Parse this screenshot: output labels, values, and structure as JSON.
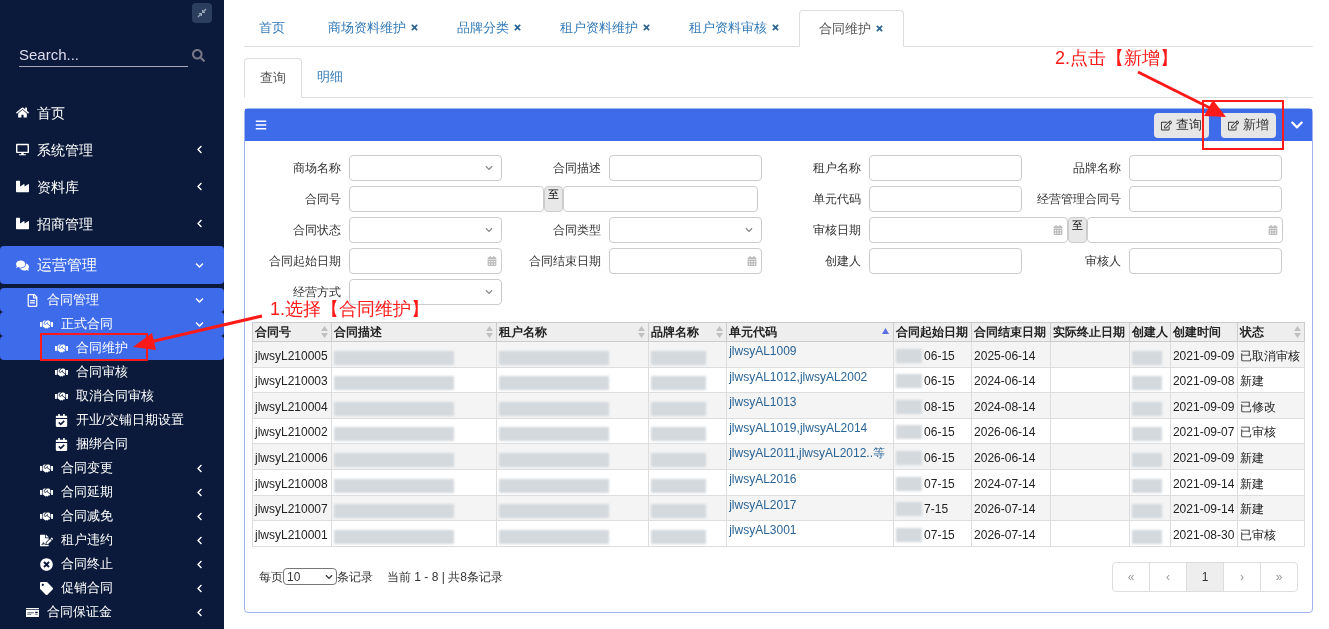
{
  "sidebar": {
    "search": {
      "placeholder": "Search..."
    },
    "items": [
      {
        "label": "首页"
      },
      {
        "label": "系统管理",
        "expanded": false
      },
      {
        "label": "资料库",
        "expanded": false
      },
      {
        "label": "招商管理",
        "expanded": false
      },
      {
        "label": "运营管理",
        "expanded": true,
        "children": [
          {
            "label": "合同管理",
            "expanded": true,
            "children": [
              {
                "label": "正式合同",
                "expanded": true,
                "children": [
                  {
                    "label": "合同维护",
                    "selected": true
                  },
                  {
                    "label": "合同审核",
                    "selected": false
                  },
                  {
                    "label": "取消合同审核",
                    "selected": false
                  },
                  {
                    "label": "开业/交铺日期设置",
                    "selected": false
                  },
                  {
                    "label": "捆绑合同",
                    "selected": false
                  }
                ]
              },
              {
                "label": "合同变更",
                "expanded": false
              },
              {
                "label": "合同延期",
                "expanded": false
              },
              {
                "label": "合同减免",
                "expanded": false
              },
              {
                "label": "租户违约",
                "expanded": false
              },
              {
                "label": "合同终止",
                "expanded": false
              },
              {
                "label": "促销合同",
                "expanded": false
              }
            ]
          },
          {
            "label": "合同保证金",
            "expanded": false
          }
        ]
      }
    ]
  },
  "tabs": [
    {
      "label": "首页",
      "selected": false
    },
    {
      "label": "商场资料维护",
      "closable": true,
      "selected": false
    },
    {
      "label": "品牌分类",
      "closable": true,
      "selected": false
    },
    {
      "label": "租户资料维护",
      "closable": true,
      "selected": false
    },
    {
      "label": "租户资料审核",
      "closable": true,
      "selected": false
    },
    {
      "label": "合同维护",
      "closable": true,
      "selected": true
    }
  ],
  "sub_tabs": [
    {
      "label": "查询",
      "selected": true
    },
    {
      "label": "明细",
      "selected": false
    }
  ],
  "toolbar": {
    "buttons": [
      "查询",
      "新增"
    ]
  },
  "filters": [
    [
      {
        "label": "商场名称",
        "kind": "select"
      },
      {
        "label": "合同描述",
        "kind": "text"
      },
      {
        "label": "租户名称",
        "kind": "text"
      },
      {
        "label": "品牌名称",
        "kind": "text"
      }
    ],
    [
      {
        "label": "合同号",
        "kind": "range",
        "separator": "至"
      },
      {
        "label": "单元代码",
        "kind": "text"
      },
      {
        "label": "经营管理合同号",
        "kind": "text"
      }
    ],
    [
      {
        "label": "合同状态",
        "kind": "select"
      },
      {
        "label": "合同类型",
        "kind": "select"
      },
      {
        "label": "审核日期",
        "kind": "daterange",
        "separator": "至"
      }
    ],
    [
      {
        "label": "合同起始日期",
        "kind": "date"
      },
      {
        "label": "合同结束日期",
        "kind": "date"
      },
      {
        "label": "创建人",
        "kind": "text"
      },
      {
        "label": "审核人",
        "kind": "text"
      }
    ],
    [
      {
        "label": "经营方式",
        "kind": "select"
      }
    ]
  ],
  "table": {
    "columns": [
      {
        "label": "合同号",
        "kind": "text",
        "sortable": true,
        "sorted": false
      },
      {
        "label": "合同描述",
        "kind": "blurred",
        "sortable": true,
        "sorted": false
      },
      {
        "label": "租户名称",
        "kind": "blurred",
        "sortable": true,
        "sorted": false
      },
      {
        "label": "品牌名称",
        "kind": "blurred",
        "sortable": true,
        "sorted": false
      },
      {
        "label": "单元代码",
        "kind": "link",
        "sortable": true,
        "sorted": true
      },
      {
        "label": "合同起始日期",
        "kind": "partial"
      },
      {
        "label": "合同结束日期",
        "kind": "text"
      },
      {
        "label": "实际终止日期",
        "kind": "text"
      },
      {
        "label": "创建人",
        "kind": "blurred"
      },
      {
        "label": "创建时间",
        "kind": "text"
      },
      {
        "label": "状态",
        "kind": "text",
        "sortable": true,
        "sorted": false
      }
    ],
    "rows": [
      [
        "jlwsyL210005",
        "",
        "",
        "",
        "jlwsyAL1009",
        "06-15",
        "2025-06-14",
        "",
        "",
        "2021-09-09",
        "已取消审核"
      ],
      [
        "jlwsyL210003",
        "",
        "",
        "",
        "jlwsyAL1012,jlwsyAL2002",
        "06-15",
        "2024-06-14",
        "",
        "",
        "2021-09-08",
        "新建"
      ],
      [
        "jlwsyL210004",
        "",
        "",
        "",
        "jlwsyAL1013",
        "08-15",
        "2024-08-14",
        "",
        "",
        "2021-09-09",
        "已修改"
      ],
      [
        "jlwsyL210002",
        "",
        "",
        "",
        "jlwsyAL1019,jlwsyAL2014",
        "06-15",
        "2026-06-14",
        "",
        "",
        "2021-09-07",
        "已审核"
      ],
      [
        "jlwsyL210006",
        "",
        "",
        "",
        "jlwsyAL2011,jlwsyAL2012..等",
        "06-15",
        "2026-06-14",
        "",
        "",
        "2021-09-09",
        "新建"
      ],
      [
        "jlwsyL210008",
        "",
        "",
        "",
        "jlwsyAL2016",
        "07-15",
        "2024-07-14",
        "",
        "",
        "2021-09-14",
        "新建"
      ],
      [
        "jlwsyL210007",
        "",
        "",
        "",
        "jlwsyAL2017",
        "7-15",
        "2026-07-14",
        "",
        "",
        "2021-09-14",
        "新建"
      ],
      [
        "jlwsyL210001",
        "",
        "",
        "",
        "jlwsyAL3001",
        "07-15",
        "2026-07-14",
        "",
        "",
        "2021-08-30",
        "已审核"
      ]
    ]
  },
  "pagination": {
    "per_page_label": "每页",
    "per_page": "10",
    "per_page_suffix": "条记录",
    "summary": "当前 1 - 8 | 共8条记录",
    "buttons": [
      {
        "label": "«",
        "selected": false
      },
      {
        "label": "‹",
        "selected": false
      },
      {
        "label": "1",
        "selected": true
      },
      {
        "label": "›",
        "selected": false
      },
      {
        "label": "»",
        "selected": false
      }
    ]
  },
  "annotations": [
    {
      "text": "1.选择【合同维护】"
    },
    {
      "text": "2.点击【新增】"
    }
  ]
}
